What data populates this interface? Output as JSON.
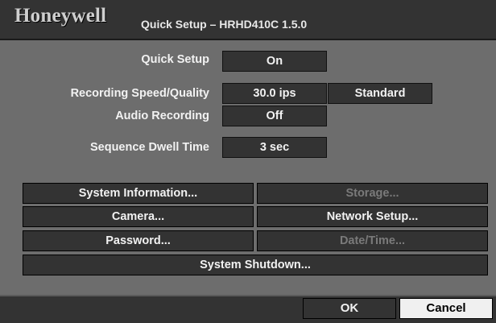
{
  "header": {
    "logo": "Honeywell",
    "title": "Quick Setup – HRHD410C 1.5.0"
  },
  "settings": {
    "quick_setup": {
      "label": "Quick Setup",
      "value": "On"
    },
    "recording": {
      "label": "Recording Speed/Quality",
      "speed": "30.0 ips",
      "quality": "Standard"
    },
    "audio": {
      "label": "Audio Recording",
      "value": "Off"
    },
    "dwell": {
      "label": "Sequence Dwell Time",
      "value": "3 sec"
    }
  },
  "buttons": {
    "system_information": "System Information...",
    "storage": "Storage...",
    "camera": "Camera...",
    "network_setup": "Network Setup...",
    "password": "Password...",
    "date_time": "Date/Time...",
    "system_shutdown": "System Shutdown..."
  },
  "footer": {
    "ok": "OK",
    "cancel": "Cancel"
  }
}
